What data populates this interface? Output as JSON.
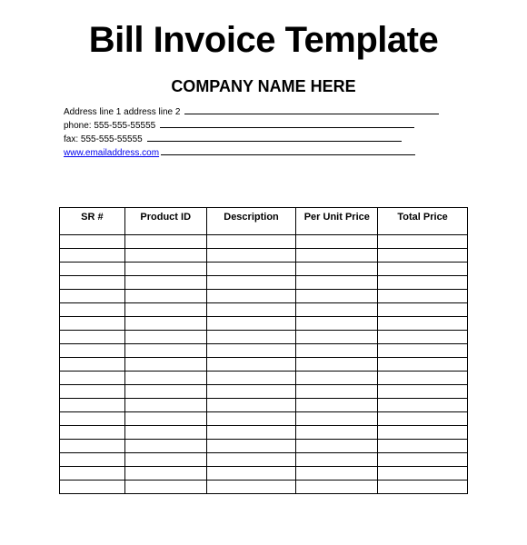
{
  "title": "Bill Invoice Template",
  "company": "COMPANY NAME HERE",
  "info": {
    "address_label": "Address line 1 address line 2 ",
    "phone_label": "phone: 555-555-55555 ",
    "fax_label": "fax: 555-555-55555 ",
    "email": "www.emailaddress.com"
  },
  "table": {
    "headers": [
      "SR #",
      "Product ID",
      "Description",
      "Per Unit Price",
      "Total Price"
    ],
    "row_count": 19
  }
}
